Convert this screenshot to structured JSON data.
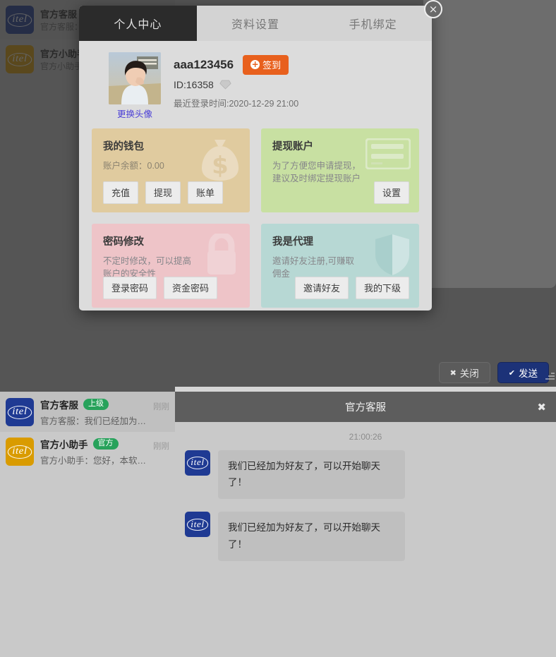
{
  "modal": {
    "close_label": "×",
    "tabs": [
      {
        "label": "个人中心",
        "active": true
      },
      {
        "label": "资料设置",
        "active": false
      },
      {
        "label": "手机绑定",
        "active": false
      }
    ],
    "profile": {
      "avatar_change_label": "更换头像",
      "username": "aaa123456",
      "signin_label": "签到",
      "signin_icon": "plus-circle-icon",
      "id_text": "ID:16358",
      "vip_icon": "diamond-icon",
      "last_login": "最近登录时间:2020-12-29 21:00"
    },
    "cards": {
      "wallet": {
        "title": "我的钱包",
        "desc": "账户余额：0.00",
        "icon": "money-bag-icon",
        "color": "#e0cb9f",
        "buttons": [
          "充值",
          "提现",
          "账单"
        ]
      },
      "withdraw": {
        "title": "提现账户",
        "desc": "为了方便您申请提现，建议及时绑定提现账户",
        "icon": "credit-card-icon",
        "color": "#c8e0a2",
        "buttons": [
          "设置"
        ]
      },
      "password": {
        "title": "密码修改",
        "desc": "不定时修改，可以提高账户的安全性",
        "icon": "lock-icon",
        "color": "#eec4c8",
        "buttons": [
          "登录密码",
          "资金密码"
        ]
      },
      "agent": {
        "title": "我是代理",
        "desc": "邀请好友注册,可赚取佣金",
        "icon": "shield-icon",
        "color": "#b7d8d4",
        "buttons": [
          "邀请好友",
          "我的下级"
        ]
      }
    }
  },
  "background": {
    "close_button": {
      "label": "关闭",
      "icon": "x-icon"
    },
    "send_button": {
      "label": "发送",
      "icon": "check-icon",
      "color": "#1c3278"
    },
    "chat_list": [
      {
        "avatar_text": "itel",
        "avatar_color": "#1f3a93",
        "name": "官方客服",
        "preview": "官方客服：我们已经加为好友了...",
        "time": "刚刚"
      },
      {
        "avatar_text": "itel",
        "avatar_color": "#d99b00",
        "name": "官方小助手",
        "preview": "官方小助手：您好，本软件正在...",
        "time": "刚刚"
      }
    ]
  },
  "im": {
    "list": [
      {
        "avatar_text": "itel",
        "avatar_color": "#1f3a93",
        "name": "官方客服",
        "badge": "上级",
        "badge_color": "#27a25b",
        "preview": "官方客服：我们已经加为好友了...",
        "time": "刚刚",
        "selected": true
      },
      {
        "avatar_text": "itel",
        "avatar_color": "#d99b00",
        "name": "官方小助手",
        "badge": "官方",
        "badge_color": "#27a25b",
        "preview": "官方小助手：您好，本软件正在...",
        "time": "刚刚",
        "selected": false
      }
    ],
    "chat": {
      "title": "官方客服",
      "close_label": "✖",
      "timestamp": "21:00:26",
      "messages": [
        {
          "avatar_text": "itel",
          "text": "我们已经加为好友了，可以开始聊天了！"
        },
        {
          "avatar_text": "itel",
          "text": "我们已经加为好友了，可以开始聊天了！"
        }
      ]
    }
  }
}
